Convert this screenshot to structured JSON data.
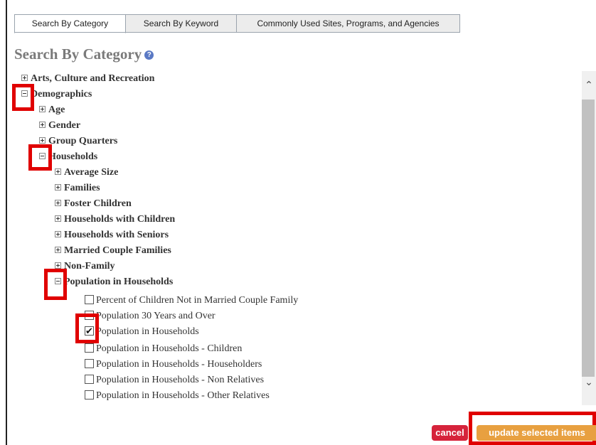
{
  "tabs": [
    {
      "label": "Search By Category",
      "active": true
    },
    {
      "label": "Search By Keyword",
      "active": false
    },
    {
      "label": "Commonly Used Sites, Programs, and Agencies",
      "active": false
    }
  ],
  "heading": {
    "title": "Search By Category",
    "help_icon": "help-circle-icon"
  },
  "tree": {
    "arts": "Arts, Culture and Recreation",
    "demographics": "Demographics",
    "age": "Age",
    "gender": "Gender",
    "group_quarters": "Group Quarters",
    "households": "Households",
    "average_size": "Average Size",
    "families": "Families",
    "foster_children": "Foster Children",
    "households_with_children": "Households with Children",
    "households_with_seniors": "Households with Seniors",
    "married_couple_families": "Married Couple Families",
    "non_family": "Non-Family",
    "population_in_households": "Population in Households",
    "leaves": [
      {
        "label": "Percent of Children Not in Married Couple Family",
        "checked": false
      },
      {
        "label": "Population 30 Years and Over",
        "checked": false
      },
      {
        "label": "Population in Households",
        "checked": true
      },
      {
        "label": "Population in Households - Children",
        "checked": false
      },
      {
        "label": "Population in Households - Householders",
        "checked": false
      },
      {
        "label": "Population in Households - Non Relatives",
        "checked": false
      },
      {
        "label": "Population in Households - Other Relatives",
        "checked": false
      }
    ]
  },
  "buttons": {
    "cancel": "cancel",
    "update": "update selected items"
  },
  "colors": {
    "highlight": "#e00000",
    "cancel": "#d6233b",
    "update": "#e8a040",
    "help": "#5a79c4"
  }
}
